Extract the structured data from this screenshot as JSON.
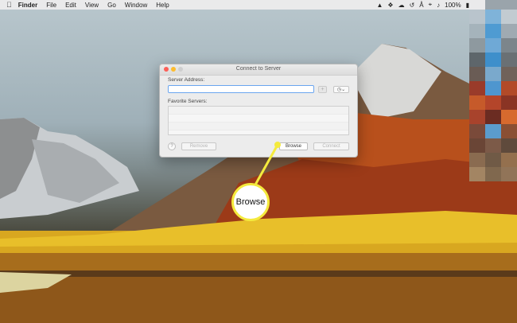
{
  "menubar": {
    "apple_icon": "apple-logo-icon",
    "items": [
      "Finder",
      "File",
      "Edit",
      "View",
      "Go",
      "Window",
      "Help"
    ],
    "status": {
      "battery": "100%",
      "icons": [
        "maps-icon",
        "dropbox-icon",
        "cloud-icon",
        "time-machine-icon",
        "bluetooth-icon",
        "wifi-icon",
        "volume-icon",
        "battery-icon"
      ]
    }
  },
  "dialog": {
    "title": "Connect to Server",
    "server_address_label": "Server Address:",
    "server_address_value": "",
    "add_button": "+",
    "history_button": "◷⌄",
    "favorites_label": "Favorite Servers:",
    "favorites": [],
    "help_button": "?",
    "remove_button": "Remove",
    "browse_button": "Browse",
    "connect_button": "Connect"
  },
  "callout": {
    "label": "Browse",
    "color": "#f4ea3d"
  },
  "colors": {
    "close": "#fc5f57",
    "minimize": "#fdbc2e",
    "focus_ring": "#6aa5ef"
  }
}
